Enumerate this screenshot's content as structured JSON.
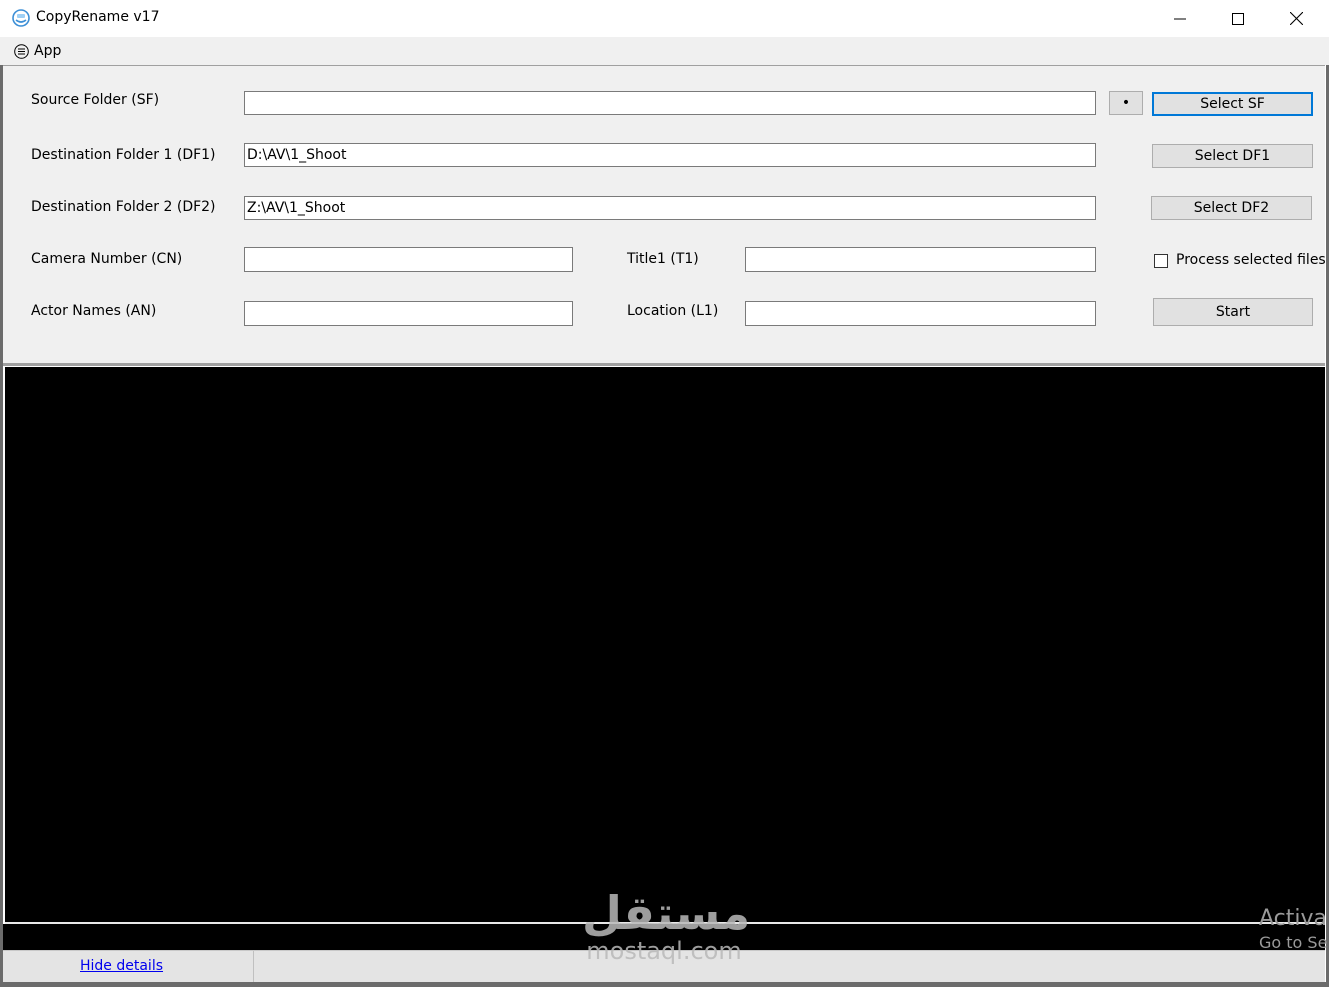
{
  "window": {
    "title": "CopyRename v17",
    "icons": {
      "app": "app-logo-icon",
      "minimize": "minimize-icon",
      "maximize": "maximize-icon",
      "close": "close-icon"
    }
  },
  "menu": {
    "app_label": "App",
    "app_icon": "hamburger-icon"
  },
  "form": {
    "source_folder": {
      "label": "Source Folder (SF)",
      "value": "",
      "dot_label": "•",
      "button": "Select SF"
    },
    "dest_folder_1": {
      "label": "Destination Folder 1 (DF1)",
      "value": "D:\\AV\\1_Shoot",
      "button": "Select DF1"
    },
    "dest_folder_2": {
      "label": "Destination Folder 2 (DF2)",
      "value": "Z:\\AV\\1_Shoot",
      "button": "Select DF2"
    },
    "camera_number": {
      "label": "Camera Number (CN)",
      "value": ""
    },
    "title1": {
      "label": "Title1 (T1)",
      "value": ""
    },
    "actor_names": {
      "label": "Actor Names (AN)",
      "value": ""
    },
    "location": {
      "label": "Location (L1)",
      "value": ""
    },
    "process_selected": {
      "label": "Process selected files",
      "checked": false
    },
    "start_button": "Start"
  },
  "status": {
    "hide_details": "Hide details"
  },
  "overlay": {
    "watermark_logo": "مستقل",
    "watermark_text": "mostaql.com",
    "activate_line1": "Activa",
    "activate_line2": "Go to Se"
  },
  "colors": {
    "accent": "#0078d7",
    "panel": "#f0f0f0",
    "console": "#000000",
    "link": "#0000ee"
  }
}
